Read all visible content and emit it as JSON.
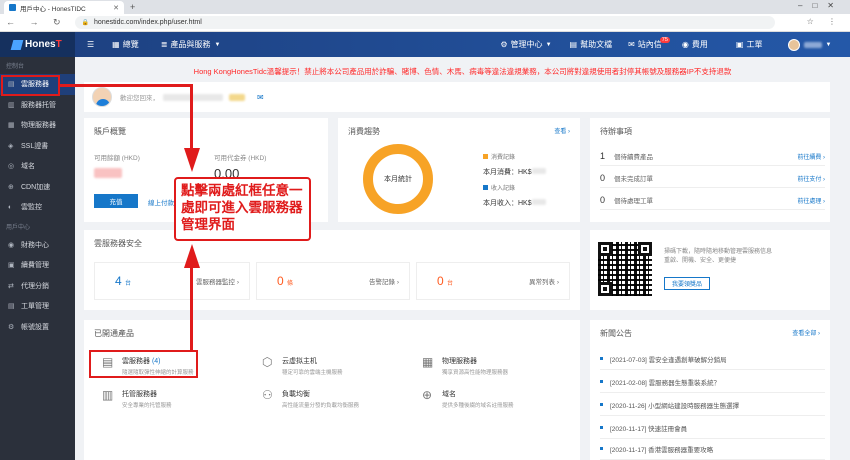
{
  "browser": {
    "tab_title": "用戶中心 - HonesTIDC",
    "url": "honestidc.com/index.php/user.html"
  },
  "topnav": {
    "logo_text": "Hones",
    "logo_accent": "T",
    "items": [
      {
        "icon": "grid-icon",
        "label": "總覽"
      },
      {
        "icon": "list-icon",
        "label": "產品與服務"
      },
      {
        "icon": "manage-icon",
        "label": "管理中心"
      },
      {
        "icon": "help-icon",
        "label": "幫助文檔"
      },
      {
        "icon": "mail-icon",
        "label": "站內信",
        "badge": "75"
      },
      {
        "icon": "fee-icon",
        "label": "費用"
      },
      {
        "icon": "ticket-icon",
        "label": "工單"
      }
    ]
  },
  "sidebar": {
    "caption1": "控制台",
    "items1": [
      {
        "label": "雲服務器",
        "icon": "server-icon",
        "active": true
      },
      {
        "label": "服務器托管",
        "icon": "rack-icon"
      },
      {
        "label": "物理服務器",
        "icon": "physical-icon"
      },
      {
        "label": "SSL證書",
        "icon": "ssl-icon"
      },
      {
        "label": "域名",
        "icon": "domain-icon"
      },
      {
        "label": "CDN加速",
        "icon": "cdn-icon"
      },
      {
        "label": "雲監控",
        "icon": "monitor-icon"
      }
    ],
    "caption2": "用戶中心",
    "items2": [
      {
        "label": "財務中心",
        "icon": "finance-icon"
      },
      {
        "label": "續費管理",
        "icon": "renew-icon"
      },
      {
        "label": "代理分銷",
        "icon": "agent-icon"
      },
      {
        "label": "工單管理",
        "icon": "ticket-icon"
      },
      {
        "label": "帳號設置",
        "icon": "account-icon"
      }
    ]
  },
  "notice": "Hong KongHonesTidc溫馨提示！禁止將本公司產品用於詐騙、賭博、色情、木馬、病毒等違法違規業務，本公司將對違規使用者封停其帳號及服務器IP不支持退款",
  "userbar": {
    "welcome": "歡迎您回來，"
  },
  "account": {
    "title": "賬戶概覽",
    "balance_label": "可用餘額 (HKD)",
    "voucher_label": "可用代金券 (HKD)",
    "voucher_value": "0.00",
    "recharge": "充值",
    "pay_link": "線上付款"
  },
  "trend": {
    "title": "消費趨勢",
    "more": "查看 ›",
    "ring_label": "本月統計",
    "legend1": "消費記錄",
    "legend2": "收入記錄",
    "spend": "本月消費：HK$",
    "income": "本月收入：HK$",
    "color1": "#f7a326",
    "color2": "#1677c9"
  },
  "todo": {
    "title": "待辦事項",
    "rows": [
      {
        "n": "1",
        "label": "個待續費產品",
        "go": "前往續費 ›"
      },
      {
        "n": "0",
        "label": "個未完成訂單",
        "go": "前往支付 ›"
      },
      {
        "n": "0",
        "label": "個待處理工單",
        "go": "前往處理 ›"
      }
    ]
  },
  "security": {
    "title": "雲服務器安全",
    "stats": [
      {
        "num": "4",
        "unit": "台",
        "label": "雲服務器監控 ›"
      },
      {
        "num": "0",
        "unit": "條",
        "label": "告警記錄 ›"
      },
      {
        "num": "0",
        "unit": "台",
        "label": "異常列表 ›"
      }
    ]
  },
  "qr": {
    "text1": "掃碼下載，隨時隨地移動管理雲服務信息",
    "text2": "重啟、開機、安全、更便捷",
    "button": "我要領獎品"
  },
  "products": {
    "title": "已開通產品",
    "items": [
      {
        "icon": "server-icon",
        "title": "雲服務器",
        "count": "(4)",
        "desc": "隨選隨取彈性伸縮的計算服務"
      },
      {
        "icon": "cube-icon",
        "title": "云虚拟主机",
        "count": "",
        "desc": "穩定可靠的雲端主機服務"
      },
      {
        "icon": "physical-icon",
        "title": "物理服務器",
        "count": "",
        "desc": "獨享資源高性能物理服務器"
      },
      {
        "icon": "rack-icon",
        "title": "托管服務器",
        "count": "",
        "desc": "安全專業的托管服務"
      },
      {
        "icon": "balance-icon",
        "title": "負載均衡",
        "count": "",
        "desc": "高性能流量分發的負載均衡服務"
      },
      {
        "icon": "globe-icon",
        "title": "域名",
        "count": "",
        "desc": "提供多種後綴的域名註冊服務"
      }
    ]
  },
  "news": {
    "title": "新聞公告",
    "more": "查看全部 ›",
    "rows": [
      {
        "text": "[2021-07-03] 雲安全逢遇創華破解分銷局"
      },
      {
        "text": "[2021-02-08] 雲服務器生態重裝系統？"
      },
      {
        "text": "[2020-11-26] 小型網站建設時服務器生態選擇"
      },
      {
        "text": "[2020-11-17] 快速註冊會員"
      },
      {
        "text": "[2020-11-17] 香港雲服務器重要攻略"
      }
    ]
  },
  "annotation": {
    "line1": "點擊兩處紅框任意一",
    "line2": "處即可進入雲服務器",
    "line3": "管理界面"
  }
}
